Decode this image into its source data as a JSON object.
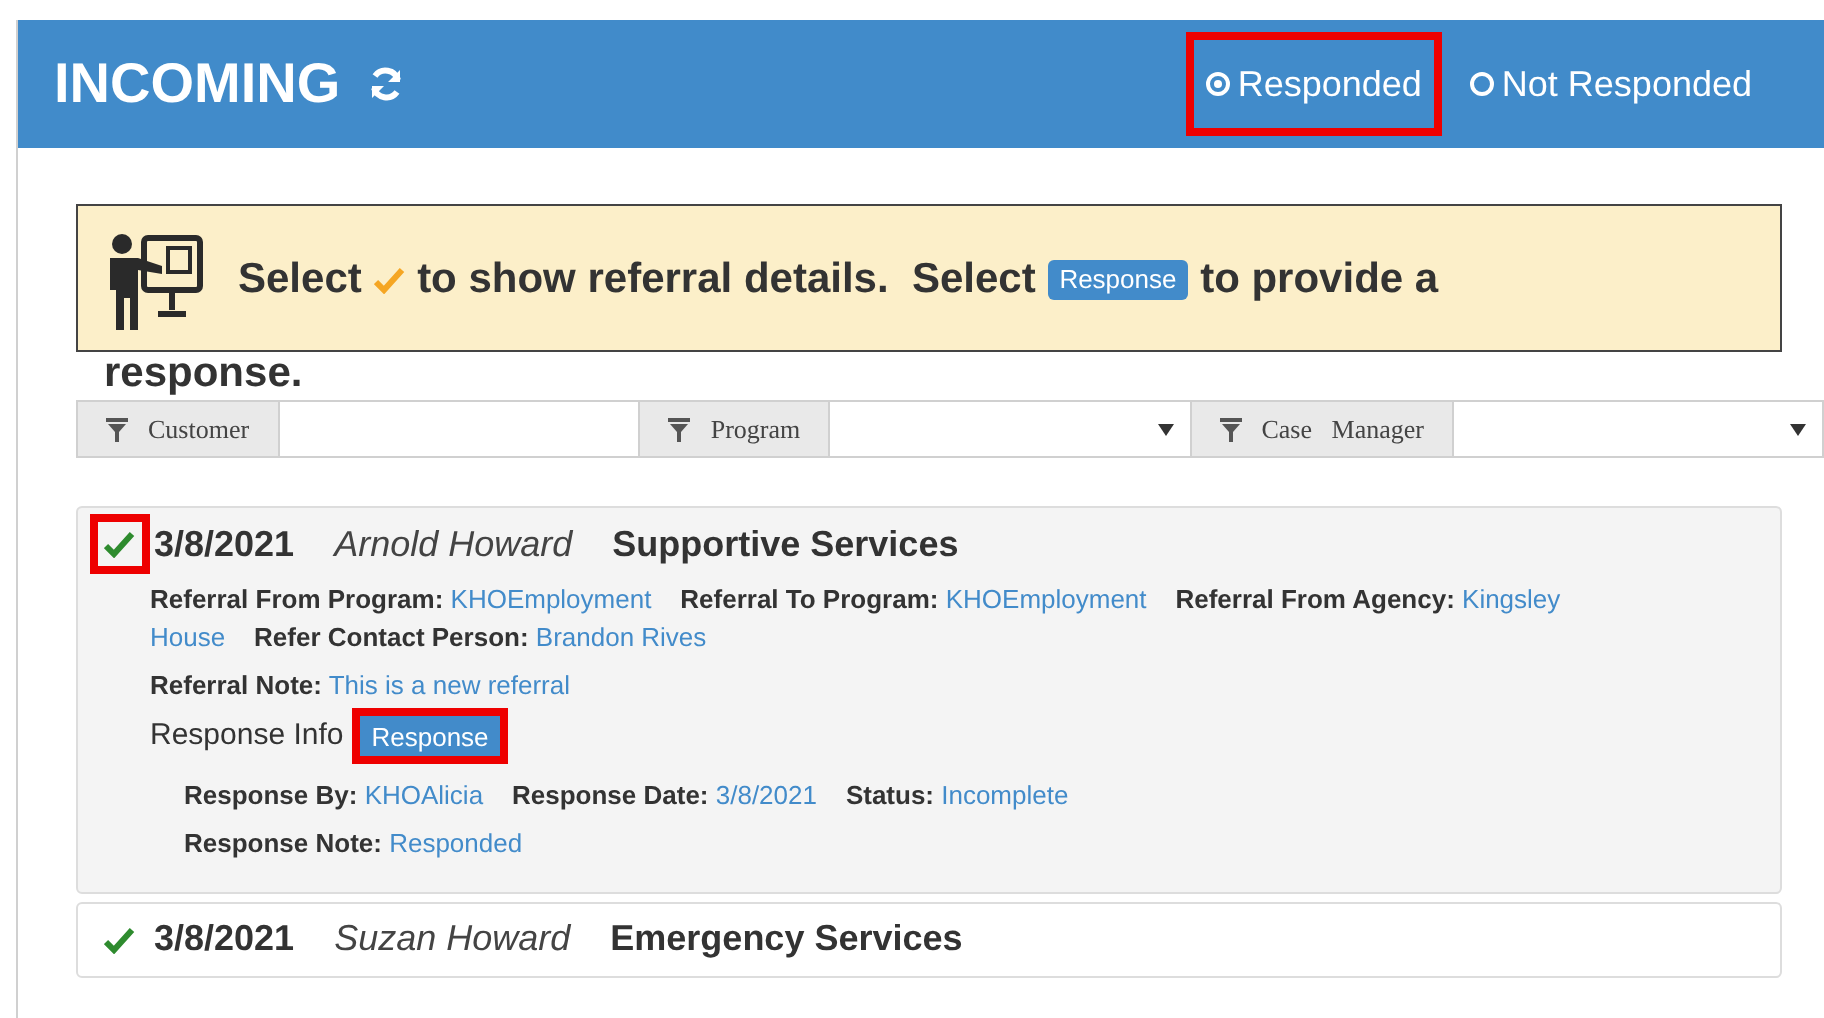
{
  "header": {
    "title": "INCOMING"
  },
  "filter_options": [
    {
      "label": "Responded",
      "selected": true,
      "highlighted": true
    },
    {
      "label": "Not Responded",
      "selected": false,
      "highlighted": false
    }
  ],
  "banner": {
    "parts": [
      {
        "kind": "text",
        "text": "Select"
      },
      {
        "kind": "check"
      },
      {
        "kind": "text",
        "text": "to show referral details.  Select"
      },
      {
        "kind": "badge",
        "text": "Response"
      },
      {
        "kind": "text",
        "text": "to provide a"
      },
      {
        "kind": "wrap",
        "text": "response."
      }
    ]
  },
  "filters": [
    {
      "label": "Customer",
      "kind": "text"
    },
    {
      "label": "Program",
      "kind": "select"
    },
    {
      "label": "Case   Manager",
      "kind": "select"
    }
  ],
  "referrals": [
    {
      "date": "3/8/2021",
      "name": "Arnold Howard",
      "service": "Supportive Services",
      "expanded": true,
      "red_frame": true,
      "detail_lines": [
        [
          {
            "label": "Referral From Program:",
            "value": "KHOEmployment"
          },
          {
            "label": "Referral To Program:",
            "value": "KHOEmployment"
          },
          {
            "label": "Referral From Agency:",
            "value": "Kingsley House"
          },
          {
            "label": "Refer Contact Person:",
            "value": "Brandon Rives"
          }
        ],
        [
          {
            "label": "Referral Note:",
            "value": "This is a new referral"
          }
        ]
      ],
      "response_info": {
        "title": "Response Info",
        "button": "Response",
        "button_highlighted": true,
        "lines": [
          [
            {
              "label": "Response By:",
              "value": "KHOAlicia"
            },
            {
              "label": "Response Date:",
              "value": "3/8/2021"
            },
            {
              "label": "Status:",
              "value": "Incomplete"
            }
          ],
          [
            {
              "label": "Response Note:",
              "value": "Responded"
            }
          ]
        ]
      }
    },
    {
      "date": "3/8/2021",
      "name": "Suzan Howard",
      "service": "Emergency Services",
      "expanded": false,
      "red_frame": false
    }
  ]
}
